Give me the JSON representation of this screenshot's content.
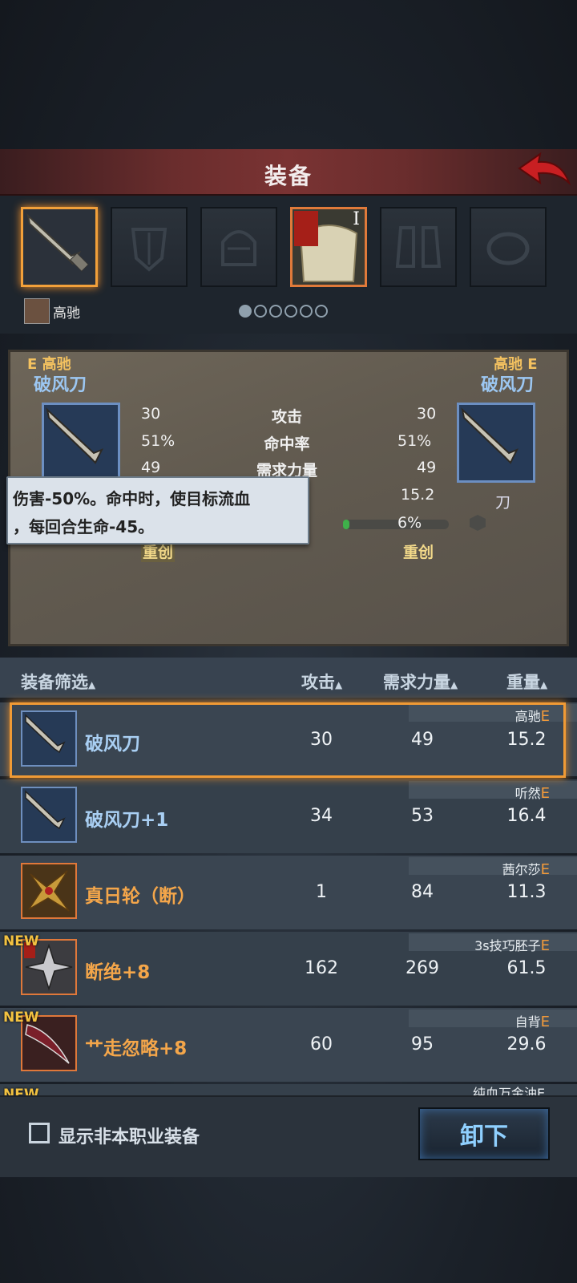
{
  "title": "装备",
  "owner": {
    "name": "高驰"
  },
  "compare": {
    "left": {
      "grade": "E",
      "owner": "高驰",
      "name": "破风刀"
    },
    "right": {
      "grade": "E",
      "owner": "高驰",
      "name": "破风刀",
      "type": "刀"
    },
    "stats": [
      {
        "label": "攻击",
        "left": "30",
        "right": "30"
      },
      {
        "label": "命中率",
        "left": "51%",
        "right": "51%"
      },
      {
        "label": "需求力量",
        "left": "49",
        "right": "49"
      },
      {
        "label": "",
        "left": "",
        "right": "15.2"
      },
      {
        "label": "",
        "left": "",
        "right": "6%"
      },
      {
        "label": "",
        "left": "重创",
        "right": "重创"
      }
    ]
  },
  "tooltip": {
    "line1": "伤害-50%。命中时，使目标流血",
    "line2": "，每回合生命-45。"
  },
  "list_header": {
    "filter": "装备筛选",
    "attack": "攻击",
    "strength": "需求力量",
    "weight": "重量"
  },
  "rows": [
    {
      "name": "破风刀",
      "owner": "高驰",
      "grade": "E",
      "attack": "30",
      "strength": "49",
      "weight": "15.2",
      "color": "#a9cff3",
      "new": ""
    },
    {
      "name": "破风刀+1",
      "owner": "听然",
      "grade": "E",
      "attack": "34",
      "strength": "53",
      "weight": "16.4",
      "color": "#a9cff3",
      "new": ""
    },
    {
      "name": "真日轮（断）",
      "owner": "茜尔莎",
      "grade": "E",
      "attack": "1",
      "strength": "84",
      "weight": "11.3",
      "color": "#f4a64a",
      "new": ""
    },
    {
      "name": "断绝+8",
      "owner": "3s技巧胚子",
      "grade": "E",
      "attack": "162",
      "strength": "269",
      "weight": "61.5",
      "color": "#f4a64a",
      "new": "NEW"
    },
    {
      "name": "艹走忽略+8",
      "owner": "自背",
      "grade": "E",
      "attack": "60",
      "strength": "95",
      "weight": "29.6",
      "color": "#f4a64a",
      "new": "NEW"
    }
  ],
  "partial_row": {
    "new": "NEW",
    "owner": "纯血万金油E"
  },
  "bottom": {
    "checkbox_label": "显示非本职业装备",
    "unequip": "卸下"
  }
}
